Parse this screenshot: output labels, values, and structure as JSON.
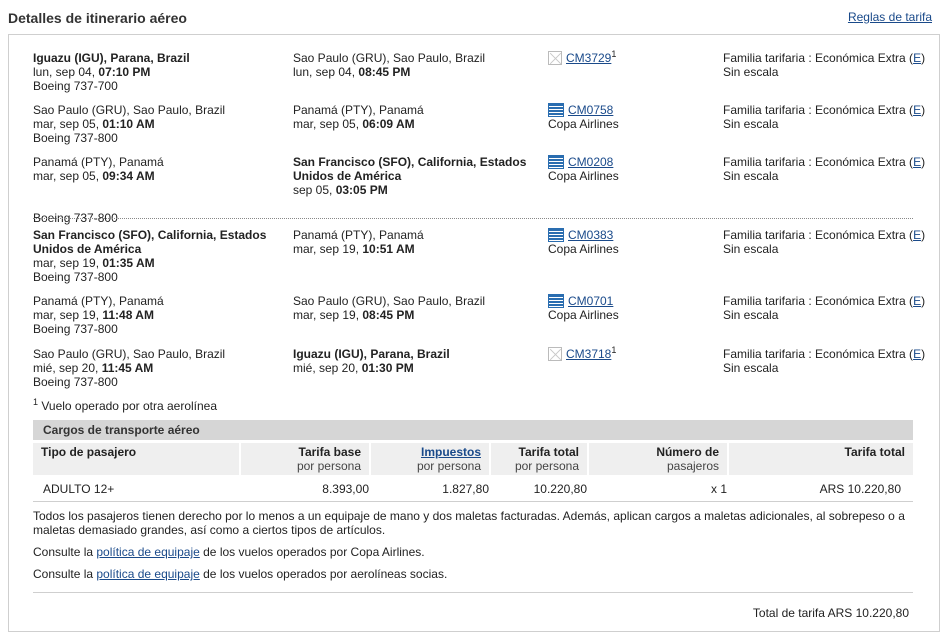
{
  "page": {
    "title": "Detalles de itinerario aéreo",
    "fare_rules_link": "Reglas de tarifa"
  },
  "segments": [
    {
      "from_place": "Iguazu (IGU), Parana, Brazil",
      "from_place_bold": true,
      "from_date": "lun, sep 04, ",
      "from_time": "07:10 PM",
      "aircraft": "Boeing 737-700",
      "to_place": "Sao Paulo (GRU), Sao Paulo, Brazil",
      "to_place_bold": false,
      "to_date": "lun, sep 04, ",
      "to_time": "08:45 PM",
      "flight": "CM3729",
      "footnote_mark": "1",
      "airline": "",
      "icon": "image-placeholder-icon",
      "fare_family": "Familia tarifaria : Económica Extra (",
      "fare_code": "E",
      "fare_close": ")",
      "stops": "Sin escala"
    },
    {
      "from_place": "Sao Paulo (GRU), Sao Paulo, Brazil",
      "from_date": "mar, sep 05, ",
      "from_time": "01:10 AM",
      "aircraft": "Boeing 737-800",
      "to_place": "Panamá (PTY), Panamá",
      "to_date": "mar, sep 05, ",
      "to_time": "06:09 AM",
      "flight": "CM0758",
      "footnote_mark": "",
      "airline": "Copa Airlines",
      "icon": "copa-airlines-logo-icon",
      "fare_family": "Familia tarifaria : Económica Extra (",
      "fare_code": "E",
      "fare_close": ")",
      "stops": "Sin escala"
    },
    {
      "from_place": "Panamá (PTY), Panamá",
      "from_date": "mar, sep 05, ",
      "from_time": "09:34 AM",
      "aircraft": "Boeing 737-800",
      "to_place": "San Francisco (SFO), California, Estados Unidos de América",
      "to_date": "sep 05, ",
      "to_time": "03:05 PM",
      "flight": "CM0208",
      "footnote_mark": "",
      "airline": "Copa Airlines",
      "icon": "copa-airlines-logo-icon",
      "fare_family": "Familia tarifaria : Económica Extra (",
      "fare_code": "E",
      "fare_close": ")",
      "stops": "Sin escala"
    },
    {
      "from_place": "San Francisco (SFO), California, Estados Unidos de América",
      "from_date": "mar, sep 19, ",
      "from_time": "01:35 AM",
      "aircraft": "Boeing 737-800",
      "to_place": "Panamá (PTY), Panamá",
      "to_date": "mar, sep 19, ",
      "to_time": "10:51 AM",
      "flight": "CM0383",
      "footnote_mark": "",
      "airline": "Copa Airlines",
      "icon": "copa-airlines-logo-icon",
      "fare_family": "Familia tarifaria : Económica Extra (",
      "fare_code": "E",
      "fare_close": ")",
      "stops": "Sin escala"
    },
    {
      "from_place": "Panamá (PTY), Panamá",
      "from_date": "mar, sep 19, ",
      "from_time": "11:48 AM",
      "aircraft": "Boeing 737-800",
      "to_place": "Sao Paulo (GRU), Sao Paulo, Brazil",
      "to_date": "mar, sep 19, ",
      "to_time": "08:45 PM",
      "flight": "CM0701",
      "footnote_mark": "",
      "airline": "Copa Airlines",
      "icon": "copa-airlines-logo-icon",
      "fare_family": "Familia tarifaria : Económica Extra (",
      "fare_code": "E",
      "fare_close": ")",
      "stops": "Sin escala"
    },
    {
      "from_place": "Sao Paulo (GRU), Sao Paulo, Brazil",
      "from_date": "mié, sep 20, ",
      "from_time": "11:45 AM",
      "aircraft": "Boeing 737-800",
      "to_place": "Iguazu (IGU), Parana, Brazil",
      "to_date": "mié, sep 20, ",
      "to_time": "01:30 PM",
      "flight": "CM3718",
      "footnote_mark": "1",
      "airline": "",
      "icon": "image-placeholder-icon",
      "fare_family": "Familia tarifaria : Económica Extra (",
      "fare_code": "E",
      "fare_close": ")",
      "stops": "Sin escala"
    }
  ],
  "footnote": {
    "mark": "1",
    "text": " Vuelo operado por otra aerolínea"
  },
  "charges": {
    "header": "Cargos de transporte aéreo",
    "columns": {
      "passenger_type": "Tipo de pasajero",
      "base_fare": "Tarifa base",
      "base_fare_sub": "por persona",
      "taxes": "Impuestos",
      "taxes_sub": "por persona",
      "total_fare": "Tarifa total",
      "total_fare_sub": "por persona",
      "num_passengers": "Número de",
      "num_passengers_sub": "pasajeros",
      "fare_total": "Tarifa total"
    },
    "row": {
      "passenger_type": "ADULTO 12+",
      "base_fare": "8.393,00",
      "taxes": "1.827,80",
      "total_fare": "10.220,80",
      "num_passengers": "x 1",
      "fare_total": "ARS 10.220,80"
    }
  },
  "notes": {
    "baggage_text": "Todos los pasajeros tienen derecho por lo menos a un equipaje de mano y dos maletas facturadas. Además, aplican cargos a maletas adicionales, al sobrepeso o a maletas demasiado grandes, así como a ciertos tipos de artículos.",
    "consult_prefix": "Consulte la ",
    "policy_link": "política de equipaje",
    "copa_suffix": " de los vuelos operados por Copa Airlines.",
    "partner_suffix": " de los vuelos operados por aerolíneas socias."
  },
  "total": {
    "label": "Total de tarifa ARS 10.220,80"
  }
}
